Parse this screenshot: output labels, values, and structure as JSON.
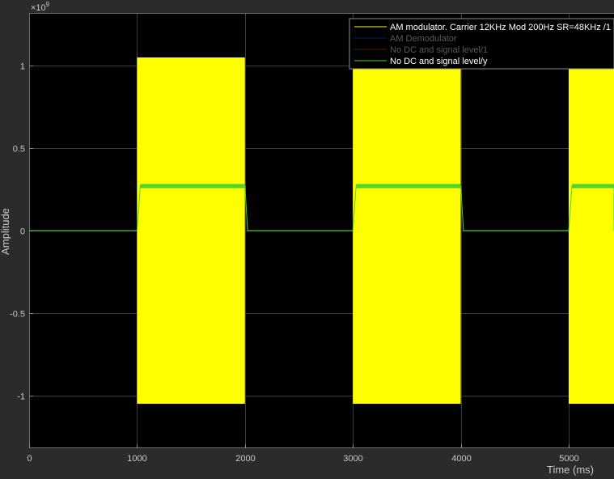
{
  "chart_data": {
    "type": "line",
    "title": "",
    "xlabel": "Time (ms)",
    "ylabel": "Amplitude",
    "exponent_label": "×10",
    "exponent_power": "9",
    "xlim": [
      0,
      5420
    ],
    "ylim": [
      -1.32,
      1.32
    ],
    "x_ticks": [
      0,
      1000,
      2000,
      3000,
      4000,
      5000
    ],
    "x_tick_labels": [
      "0",
      "1000",
      "2000",
      "3000",
      "4000",
      "5000"
    ],
    "y_ticks": [
      -1,
      -0.5,
      0,
      0.5,
      1
    ],
    "y_tick_labels": [
      "-1",
      "-0.5",
      "0",
      "0.5",
      "1"
    ],
    "grid": true,
    "legend_position": "top-right",
    "series": [
      {
        "name": "AM modulator. Carrier 12KHz Mod 200Hz SR=48KHz /1",
        "color": "#ffff00",
        "legend_text_color": "#ffffff",
        "kind": "envelope-bursts",
        "amplitude": 1.05,
        "bursts": [
          [
            1000,
            2000
          ],
          [
            3000,
            4000
          ],
          [
            5000,
            6000
          ]
        ]
      },
      {
        "name": "AM Demodulator",
        "color": "#1f3fbf",
        "legend_text_color": "#5a5a5a",
        "kind": "hidden"
      },
      {
        "name": "No DC and signal level/1",
        "color": "#b03020",
        "legend_text_color": "#5a5a5a",
        "kind": "hidden"
      },
      {
        "name": "No DC and signal level/y",
        "color": "#4ed32f",
        "legend_text_color": "#ffffff",
        "kind": "square-levels",
        "high": 0.27,
        "low": 0,
        "bursts": [
          [
            1000,
            2000
          ],
          [
            3000,
            4000
          ],
          [
            5000,
            6000
          ]
        ]
      }
    ]
  }
}
